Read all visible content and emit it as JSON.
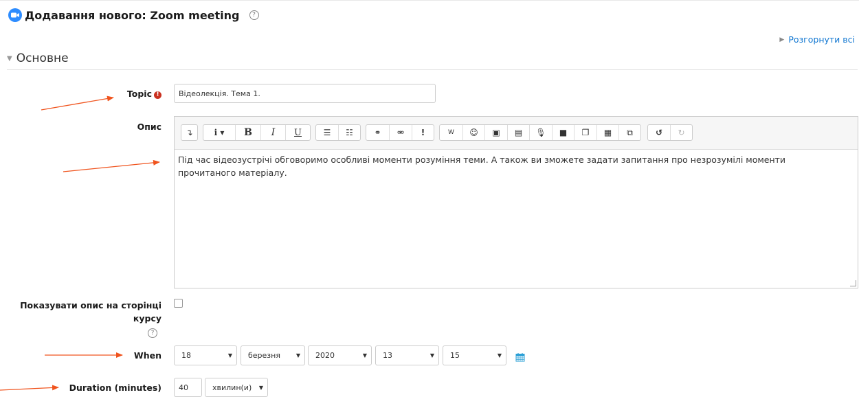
{
  "header": {
    "title": "Додавання нового: Zoom meeting",
    "help_icon": "?"
  },
  "expand_all": "Розгорнути всі",
  "section": {
    "title": "Основне"
  },
  "topic": {
    "label": "Topic",
    "value": "Відеолекція. Тема 1."
  },
  "description": {
    "label": "Опис",
    "content": "Під час відеозустрічі обговоримо особливі моменти розуміння теми. А також ви зможете задати запитання про незрозумілі моменти прочитаного матеріалу."
  },
  "show_description": {
    "label": "Показувати опис на сторінці курсу",
    "help": "?"
  },
  "when": {
    "label": "When",
    "day": "18",
    "month": "березня",
    "year": "2020",
    "hour": "13",
    "minute": "15"
  },
  "duration": {
    "label": "Duration (minutes)",
    "value": "40",
    "unit": "хвилин(и)"
  },
  "colors": {
    "accent_link": "#1177d1",
    "zoom_blue": "#2d8cff",
    "required_red": "#ca3120",
    "arrow": "#f0541e"
  }
}
